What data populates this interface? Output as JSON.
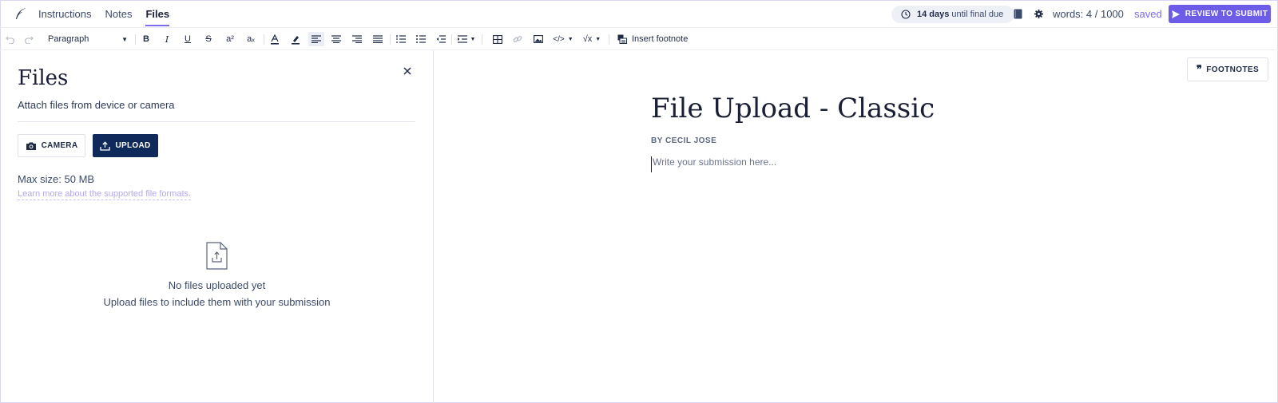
{
  "nav": {
    "tabs": [
      {
        "label": "Instructions"
      },
      {
        "label": "Notes"
      },
      {
        "label": "Files"
      }
    ],
    "due_bold": "14 days",
    "due_rest": "until final due",
    "words": "words:  4 / 1000",
    "saved": "saved",
    "submit_label": "REVIEW TO SUBMIT",
    "accent": "#6c5ce7"
  },
  "toolbar": {
    "paragraph": "Paragraph",
    "superscript": "a²",
    "subscript": "aₓ",
    "bold": "B",
    "italic": "I",
    "underline": "U",
    "strike": "S",
    "code": "</>",
    "math": "√x",
    "insert_footnote": "Insert footnote"
  },
  "files_panel": {
    "title": "Files",
    "subtitle": "Attach files from device or camera",
    "camera_label": "CAMERA",
    "upload_label": "UPLOAD",
    "max_size": "Max size: 50 MB",
    "learn_more": "Learn more about the supported file formats.",
    "empty_title": "No files uploaded yet",
    "empty_sub": "Upload files to include them with your submission",
    "upload_color": "#0f2a5a"
  },
  "editor": {
    "footnotes_label": "FOOTNOTES",
    "title": "File Upload - Classic",
    "byline": "BY CECIL JOSE",
    "placeholder": "Write your submission here..."
  }
}
